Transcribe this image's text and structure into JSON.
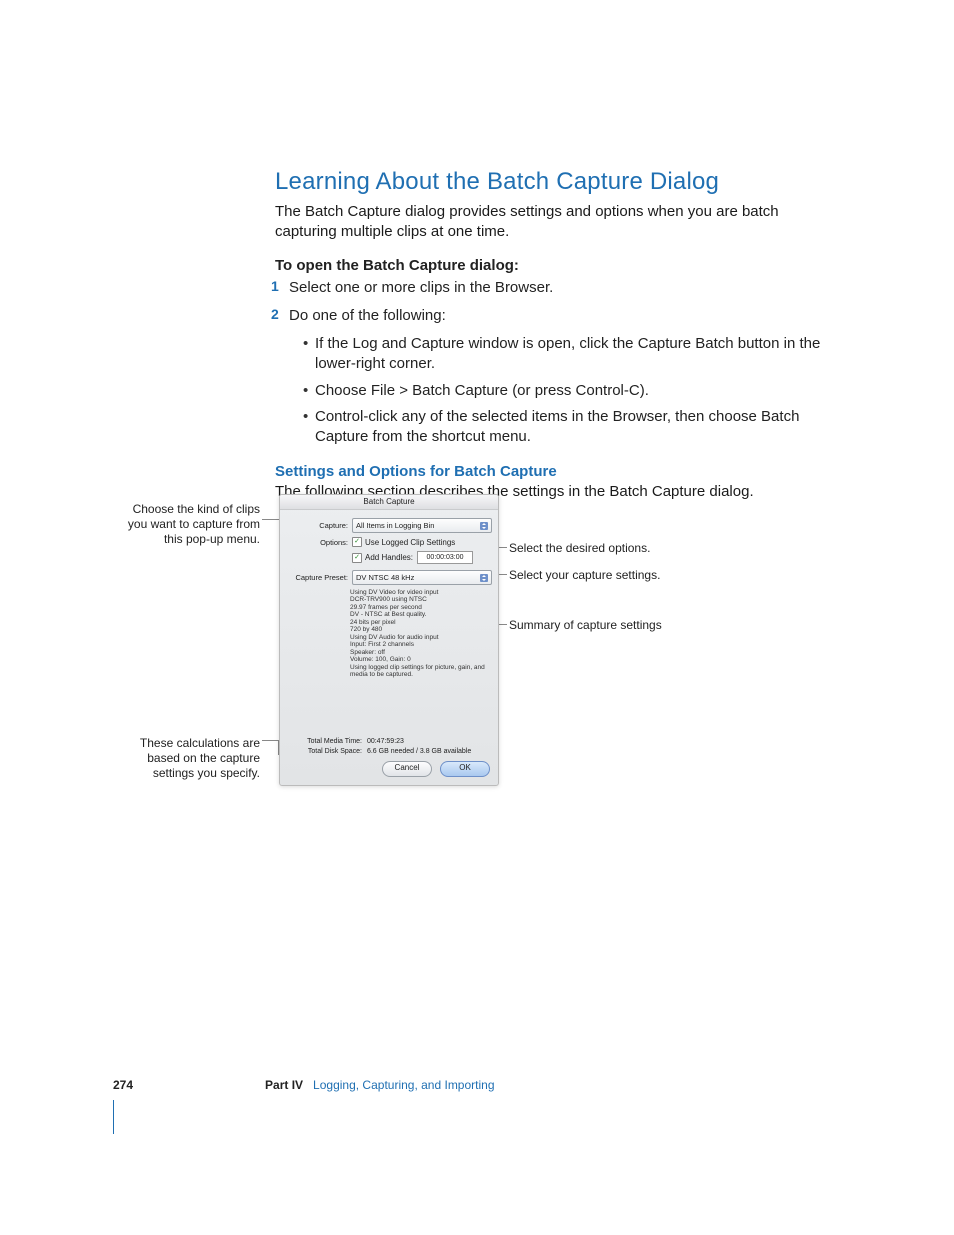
{
  "heading": "Learning About the Batch Capture Dialog",
  "intro": "The Batch Capture dialog provides settings and options when you are batch capturing multiple clips at one time.",
  "procedure_title": "To open the Batch Capture dialog:",
  "steps": {
    "s1": "Select one or more clips in the Browser.",
    "s2": "Do one of the following:"
  },
  "step_nums": {
    "n1": "1",
    "n2": "2"
  },
  "options": {
    "o1": "If the Log and Capture window is open, click the Capture Batch button in the lower-right corner.",
    "o2": "Choose File > Batch Capture (or press Control-C).",
    "o3": "Control-click any of the selected items in the Browser, then choose Batch Capture from the shortcut menu."
  },
  "sub_blue": "Settings and Options for Batch Capture",
  "sub_desc": "The following section describes the settings in the Batch Capture dialog.",
  "callouts": {
    "c_left1": "Choose the kind of clips you want to capture from this pop-up menu.",
    "c_left2": "These calculations are based on the capture settings you specify.",
    "c_right1": "Select the desired options.",
    "c_right2": "Select your capture settings.",
    "c_right3": "Summary of capture settings"
  },
  "dialog": {
    "title": "Batch Capture",
    "capture_label": "Capture:",
    "capture_value": "All Items in Logging Bin",
    "options_label": "Options:",
    "opt_use_logged": "Use Logged Clip Settings",
    "opt_add_handles": "Add Handles:",
    "handles_tc": "00:00:03:00",
    "preset_label": "Capture Preset:",
    "preset_value": "DV NTSC 48 kHz",
    "summary_lines": {
      "l1": "Using DV Video for video input",
      "l2": "DCR-TRV900 using NTSC",
      "l3": "29.97 frames per second",
      "l4": "DV - NTSC at Best quality.",
      "l5": "24 bits per pixel",
      "l6": "720 by 480",
      "l7": "Using DV Audio for audio input",
      "l8": "Input: First 2 channels",
      "l9": "Speaker: off",
      "l10": "Volume: 100, Gain: 0",
      "l11": "Using logged clip settings for picture, gain, and media to be captured."
    },
    "media_time_label": "Total Media Time:",
    "media_time_value": "00:47:59:23",
    "disk_space_label": "Total Disk Space:",
    "disk_space_value": "6.6 GB needed / 3.8 GB available",
    "btn_cancel": "Cancel",
    "btn_ok": "OK"
  },
  "footer": {
    "page_no": "274",
    "part_label": "Part IV",
    "part_title": "Logging, Capturing, and Importing"
  }
}
